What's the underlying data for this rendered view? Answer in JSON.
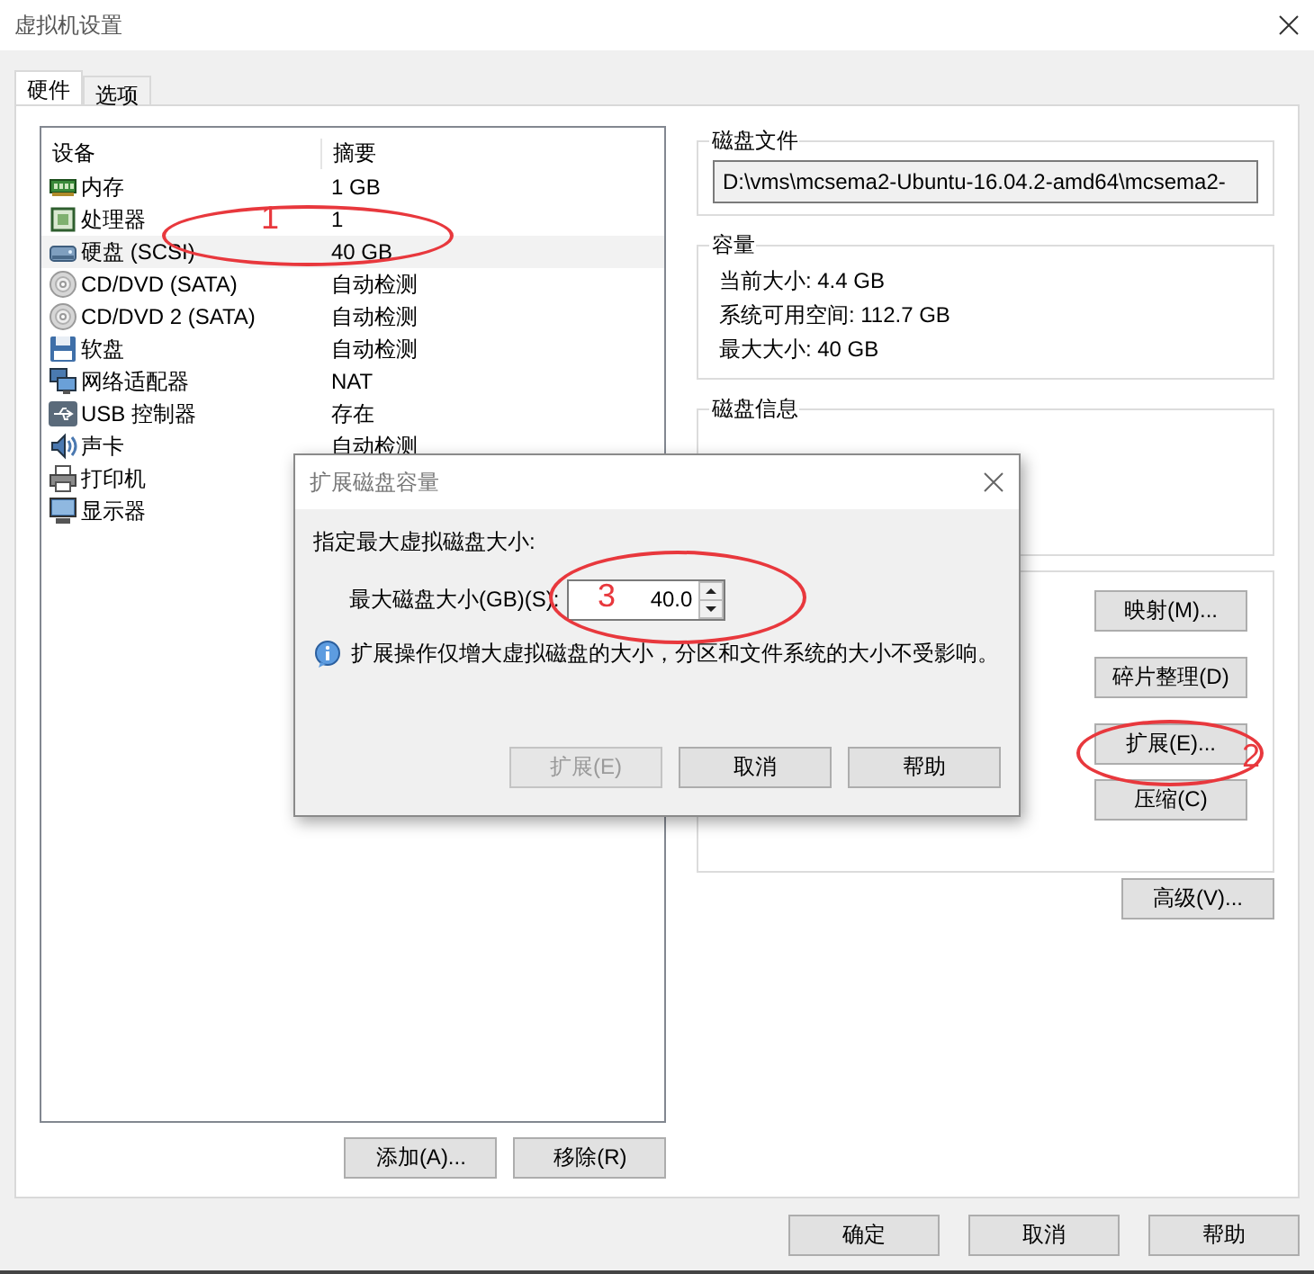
{
  "window": {
    "title": "虚拟机设置"
  },
  "tabs": [
    {
      "label": "硬件",
      "selected": true
    },
    {
      "label": "选项",
      "selected": false
    }
  ],
  "device_table": {
    "columns": [
      "设备",
      "摘要"
    ],
    "rows": [
      {
        "kind": "memory",
        "device": "内存",
        "summary": "1 GB",
        "selected": false
      },
      {
        "kind": "cpu",
        "device": "处理器",
        "summary": "1",
        "selected": false
      },
      {
        "kind": "disk",
        "device": "硬盘 (SCSI)",
        "summary": "40 GB",
        "selected": true
      },
      {
        "kind": "cdrom",
        "device": "CD/DVD (SATA)",
        "summary": "自动检测",
        "selected": false
      },
      {
        "kind": "cdrom",
        "device": "CD/DVD 2 (SATA)",
        "summary": "自动检测",
        "selected": false
      },
      {
        "kind": "floppy",
        "device": "软盘",
        "summary": "自动检测",
        "selected": false
      },
      {
        "kind": "network",
        "device": "网络适配器",
        "summary": "NAT",
        "selected": false
      },
      {
        "kind": "usb",
        "device": "USB 控制器",
        "summary": "存在",
        "selected": false
      },
      {
        "kind": "sound",
        "device": "声卡",
        "summary": "自动检测",
        "selected": false
      },
      {
        "kind": "printer",
        "device": "打印机",
        "selected": false
      },
      {
        "kind": "display",
        "device": "显示器",
        "selected": false
      }
    ]
  },
  "device_buttons": [
    "添加(A)...",
    "移除(R)"
  ],
  "disk_file": {
    "title": "磁盘文件",
    "path": "D:\\vms\\mcsema2-Ubuntu-16.04.2-amd64\\mcsema2-"
  },
  "capacity": {
    "title": "容量",
    "lines": [
      "当前大小: 4.4 GB",
      "系统可用空间: 112.7 GB",
      "最大大小: 40 GB"
    ]
  },
  "disk_info": {
    "title": "磁盘信息"
  },
  "utility_buttons": [
    "映射(M)...",
    "碎片整理(D)",
    "扩展(E)...",
    "压缩(C)"
  ],
  "advanced_button": "高级(V)...",
  "footer_buttons": [
    "确定",
    "取消",
    "帮助"
  ],
  "dialog": {
    "title": "扩展磁盘容量",
    "prompt": "指定最大虚拟磁盘大小:",
    "size_label": "最大磁盘大小(GB)(S):",
    "size_value": "40.0",
    "info": "扩展操作仅增大虚拟磁盘的大小，分区和文件系统的大小不受影响。",
    "buttons": [
      {
        "label": "扩展(E)",
        "disabled": true
      },
      {
        "label": "取消",
        "disabled": false
      },
      {
        "label": "帮助",
        "disabled": false
      }
    ]
  },
  "annotations": [
    {
      "label": "1"
    },
    {
      "label": "2"
    },
    {
      "label": "3"
    }
  ]
}
